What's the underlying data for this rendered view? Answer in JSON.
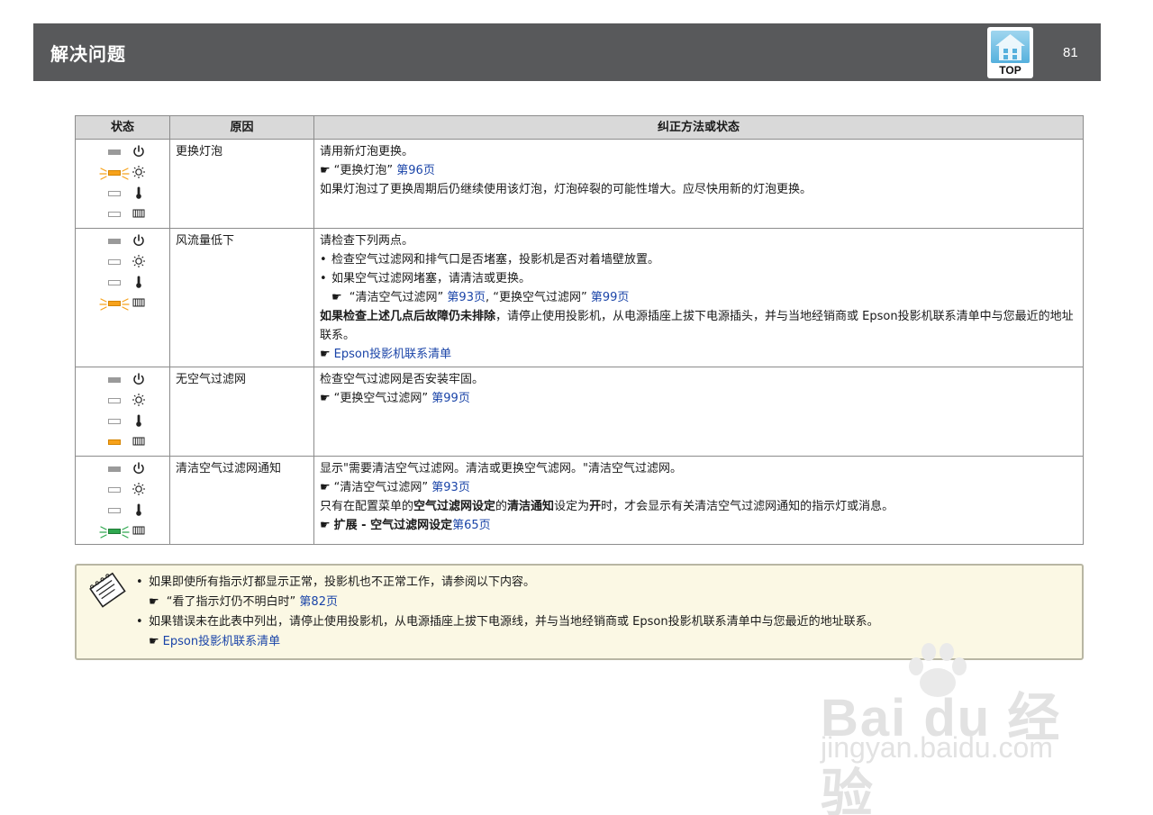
{
  "header": {
    "title": "解决问题",
    "top_label": "TOP",
    "page_number": "81"
  },
  "table": {
    "columns": [
      "状态",
      "原因",
      "纠正方法或状态"
    ],
    "rows": [
      {
        "indicators": [
          {
            "lamp": "gray",
            "blink": false,
            "icon": "power-icon"
          },
          {
            "lamp": "orange",
            "blink": true,
            "icon": "lamp-sun-icon"
          },
          {
            "lamp": "off",
            "blink": false,
            "icon": "thermometer-icon"
          },
          {
            "lamp": "off",
            "blink": false,
            "icon": "filter-icon"
          }
        ],
        "cause": "更换灯泡",
        "line1": "请用新灯泡更换。",
        "ref_hand": "☛",
        "ref_text": "“更换灯泡”",
        "ref_page": "第96页",
        "line3": "如果灯泡过了更换周期后仍继续使用该灯泡，灯泡碎裂的可能性增大。应尽快用新的灯泡更换。"
      },
      {
        "indicators": [
          {
            "lamp": "gray",
            "blink": false,
            "icon": "power-icon"
          },
          {
            "lamp": "off",
            "blink": false,
            "icon": "lamp-sun-icon"
          },
          {
            "lamp": "off",
            "blink": false,
            "icon": "thermometer-icon"
          },
          {
            "lamp": "orange",
            "blink": true,
            "icon": "filter-icon"
          }
        ],
        "cause": "风流量低下",
        "line1": "请检查下列两点。",
        "bullet1": "检查空气过滤网和排气口是否堵塞，投影机是否对着墙壁放置。",
        "bullet2": "如果空气过滤网堵塞，请清洁或更换。",
        "ref_hand": "☛",
        "ref1_text": "“清洁空气过滤网”",
        "ref1_page": "第93页",
        "ref_sep": ",",
        "ref2_text": "“更换空气过滤网”",
        "ref2_page": "第99页",
        "para_bold": "如果检查上述几点后故障仍未排除",
        "para_rest": "，请停止使用投影机，从电源插座上拔下电源插头，并与当地经销商或 Epson投影机联系清单中与您最近的地址联系。",
        "link": "Epson投影机联系清单"
      },
      {
        "indicators": [
          {
            "lamp": "gray",
            "blink": false,
            "icon": "power-icon"
          },
          {
            "lamp": "off",
            "blink": false,
            "icon": "lamp-sun-icon"
          },
          {
            "lamp": "off",
            "blink": false,
            "icon": "thermometer-icon"
          },
          {
            "lamp": "orange",
            "blink": false,
            "icon": "filter-icon"
          }
        ],
        "cause": "无空气过滤网",
        "line1": "检查空气过滤网是否安装牢固。",
        "ref_hand": "☛",
        "ref_text": "“更换空气过滤网”",
        "ref_page": "第99页"
      },
      {
        "indicators": [
          {
            "lamp": "gray",
            "blink": false,
            "icon": "power-icon"
          },
          {
            "lamp": "off",
            "blink": false,
            "icon": "lamp-sun-icon"
          },
          {
            "lamp": "off",
            "blink": false,
            "icon": "thermometer-icon"
          },
          {
            "lamp": "green",
            "blink": true,
            "icon": "filter-icon"
          }
        ],
        "cause": "清洁空气过滤网通知",
        "line1": "显示\"需要清洁空气过滤网。清洁或更换空气滤网。\"清洁空气过滤网。",
        "ref_hand": "☛",
        "ref_text": "“清洁空气过滤网”",
        "ref_page": "第93页",
        "l3a": "只有在配置菜单的",
        "l3b": "空气过滤网设定",
        "l3c": "的",
        "l3d": "清洁通知",
        "l3e": "设定为",
        "l3f": "开",
        "l3g": "时，才会显示有关清洁空气过滤网通知的指示灯或消息。",
        "ref2_bold": "扩展 - 空气过滤网设定",
        "ref2_page": "第65页"
      }
    ]
  },
  "note": {
    "bullet": "•",
    "hand": "☛",
    "item1": "如果即使所有指示灯都显示正常，投影机也不正常工作，请参阅以下内容。",
    "item1_ref": "“看了指示灯仍不明白时”",
    "item1_page": "第82页",
    "item2": "如果错误未在此表中列出，请停止使用投影机，从电源插座上拔下电源线，并与当地经销商或  Epson投影机联系清单中与您最近的地址联系。",
    "item2_link": "Epson投影机联系清单"
  },
  "watermark": {
    "brand": "Bai du 经验",
    "url": "jingyan.baidu.com"
  },
  "colors": {
    "header_bg": "#58595b",
    "link": "#1a44a8",
    "lamp_orange": "#f7a21b",
    "lamp_green": "#2fa84f",
    "note_bg": "#fbf8e4"
  }
}
